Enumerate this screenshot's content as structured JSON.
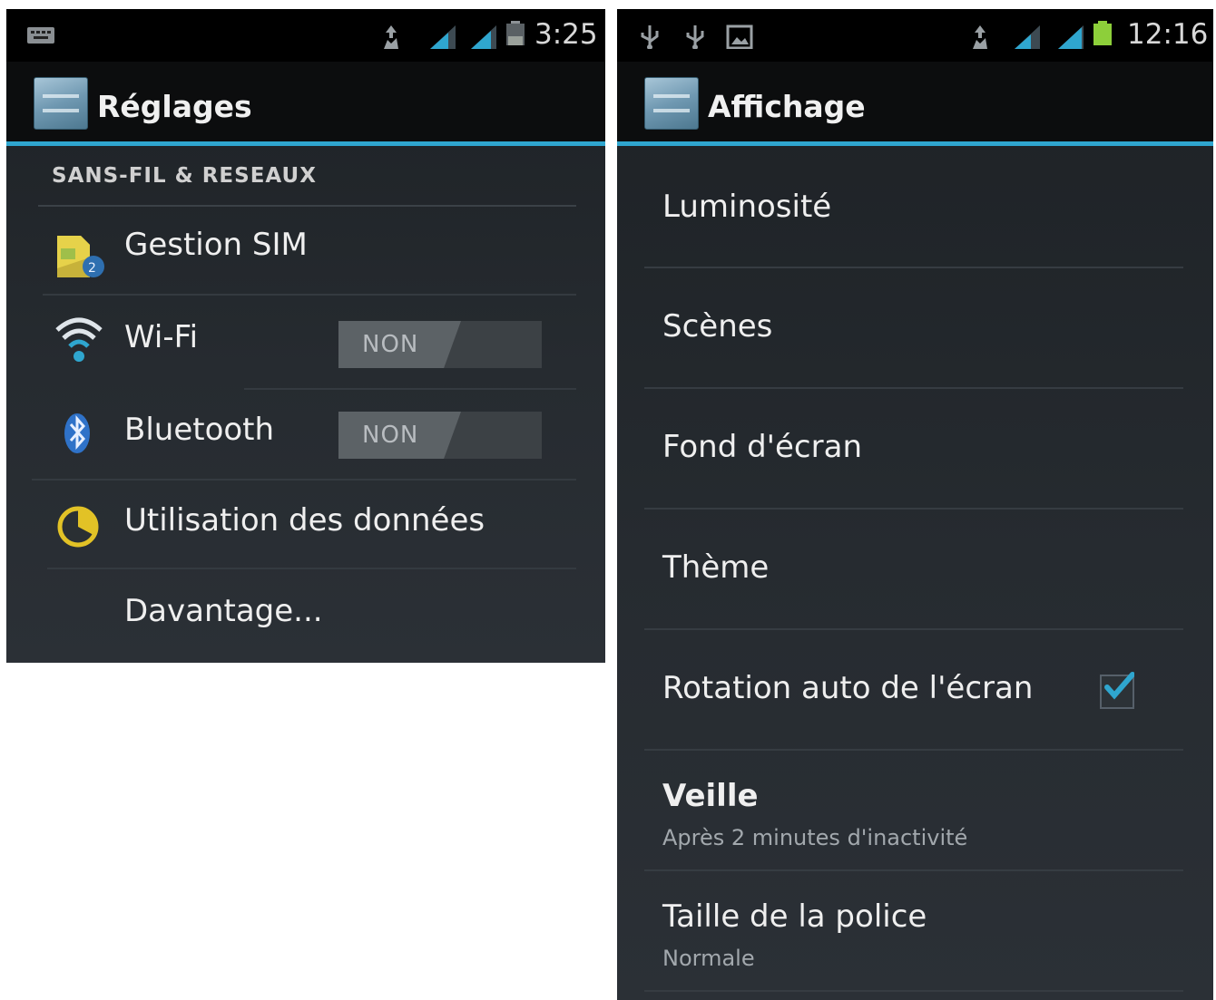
{
  "left": {
    "clock": "3:25",
    "title": "Réglages",
    "section_header": "SANS-FIL & RESEAUX",
    "items": [
      {
        "label": "Gestion SIM"
      },
      {
        "label": "Wi-Fi",
        "toggle": "NON"
      },
      {
        "label": "Bluetooth",
        "toggle": "NON"
      },
      {
        "label": "Utilisation des données"
      },
      {
        "label": "Davantage..."
      }
    ]
  },
  "right": {
    "clock": "12:16",
    "title": "Affichage",
    "items": [
      {
        "label": "Luminosité"
      },
      {
        "label": "Scènes"
      },
      {
        "label": "Fond d'écran"
      },
      {
        "label": "Thème"
      },
      {
        "label": "Rotation auto de l'écran",
        "checked": true
      },
      {
        "label": "Veille",
        "summary": "Après 2 minutes d'inactivité"
      },
      {
        "label": "Taille de la police",
        "summary": "Normale"
      }
    ]
  },
  "colors": {
    "accent": "#2fa6cf",
    "background": "#22272c"
  }
}
